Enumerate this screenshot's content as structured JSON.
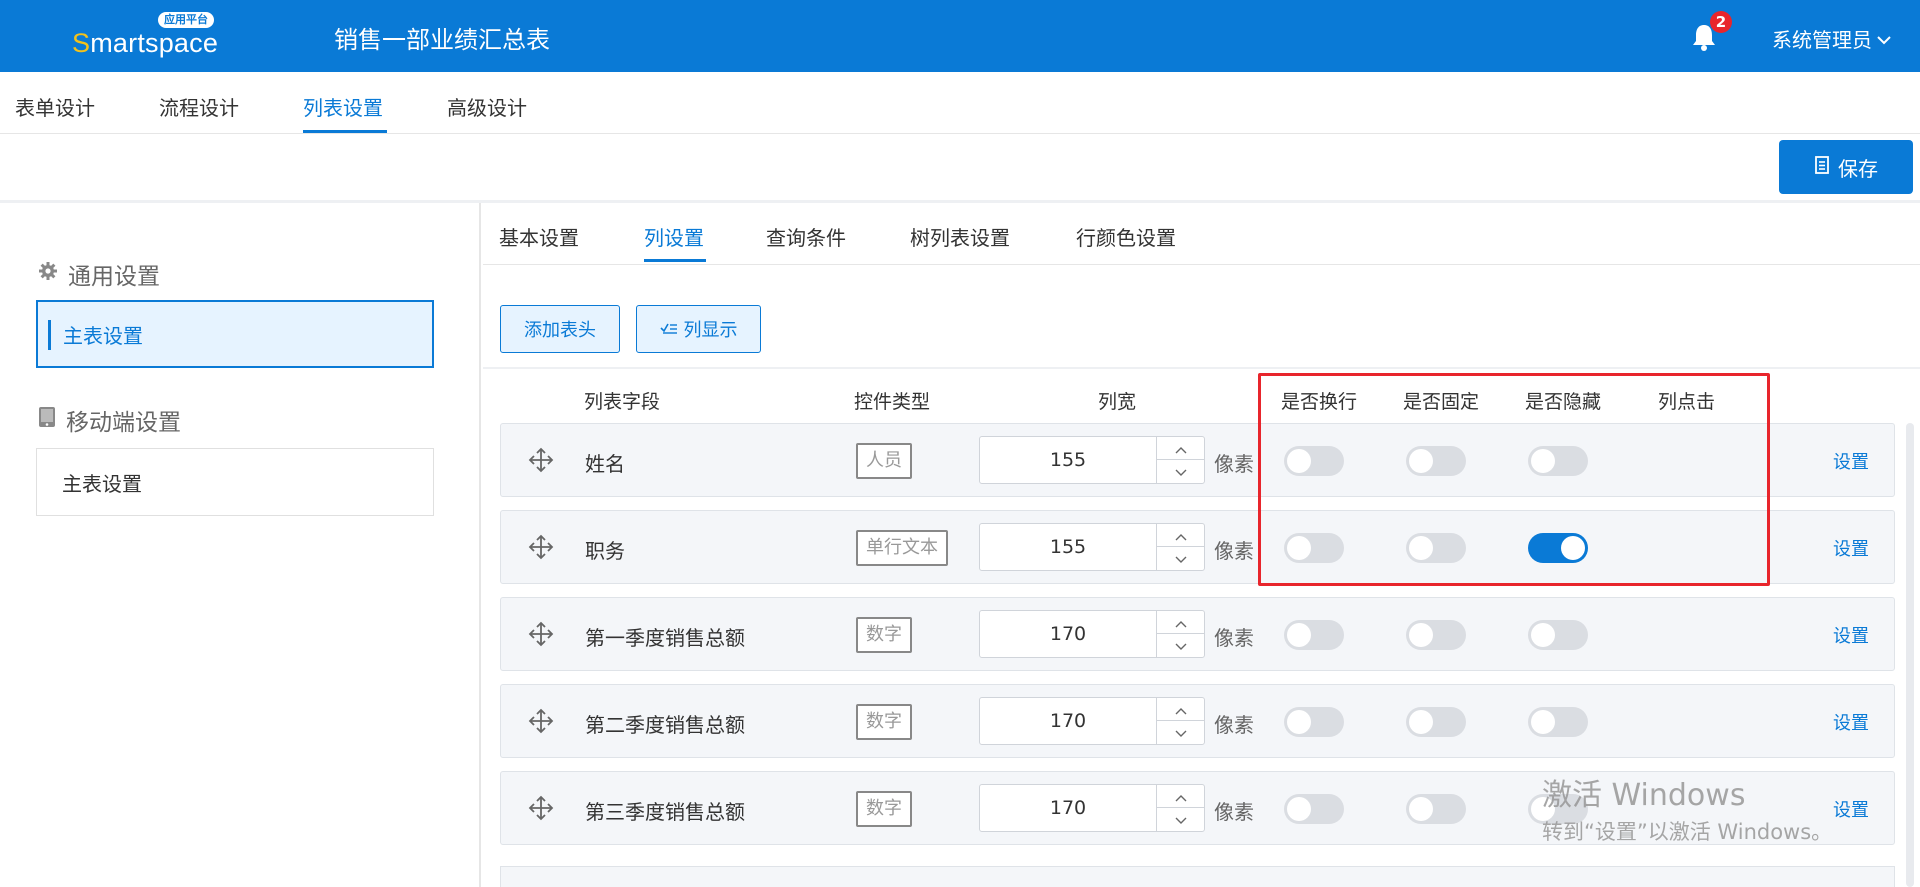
{
  "header": {
    "logo_text_first": "S",
    "logo_text_rest": "martspace",
    "logo_badge": "应用平台",
    "title": "销售一部业绩汇总表",
    "notification_count": "2",
    "user_name": "系统管理员"
  },
  "top_tabs": [
    "表单设计",
    "流程设计",
    "列表设置",
    "高级设计"
  ],
  "active_top_tab": "列表设置",
  "save_label": "保存",
  "sidebar": {
    "general_title": "通用设置",
    "general_item": "主表设置",
    "mobile_title": "移动端设置",
    "mobile_item": "主表设置"
  },
  "sub_tabs": [
    "基本设置",
    "列设置",
    "查询条件",
    "树列表设置",
    "行颜色设置"
  ],
  "active_sub_tab": "列设置",
  "toolbar": {
    "add_header_label": "添加表头",
    "column_display_label": "列显示"
  },
  "columns": {
    "field": "列表字段",
    "control_type": "控件类型",
    "width": "列宽",
    "wrap": "是否换行",
    "fixed": "是否固定",
    "hidden": "是否隐藏",
    "click": "列点击"
  },
  "rows": [
    {
      "field": "姓名",
      "control_type": "人员",
      "width": "155",
      "unit": "像素",
      "wrap": false,
      "fixed": false,
      "hidden": false,
      "action": "设置"
    },
    {
      "field": "职务",
      "control_type": "单行文本",
      "width": "155",
      "unit": "像素",
      "wrap": false,
      "fixed": false,
      "hidden": true,
      "action": "设置"
    },
    {
      "field": "第一季度销售总额",
      "control_type": "数字",
      "width": "170",
      "unit": "像素",
      "wrap": false,
      "fixed": false,
      "hidden": false,
      "action": "设置"
    },
    {
      "field": "第二季度销售总额",
      "control_type": "数字",
      "width": "170",
      "unit": "像素",
      "wrap": false,
      "fixed": false,
      "hidden": false,
      "action": "设置"
    },
    {
      "field": "第三季度销售总额",
      "control_type": "数字",
      "width": "170",
      "unit": "像素",
      "wrap": false,
      "fixed": false,
      "hidden": false,
      "action": "设置"
    }
  ],
  "watermark": {
    "title": "激活 Windows",
    "subtitle": "转到“设置”以激活 Windows。"
  },
  "colors": {
    "primary": "#0a7ad6",
    "highlight": "#e8252c",
    "badge": "#e8252c",
    "logo_accent": "#f3c21b"
  }
}
